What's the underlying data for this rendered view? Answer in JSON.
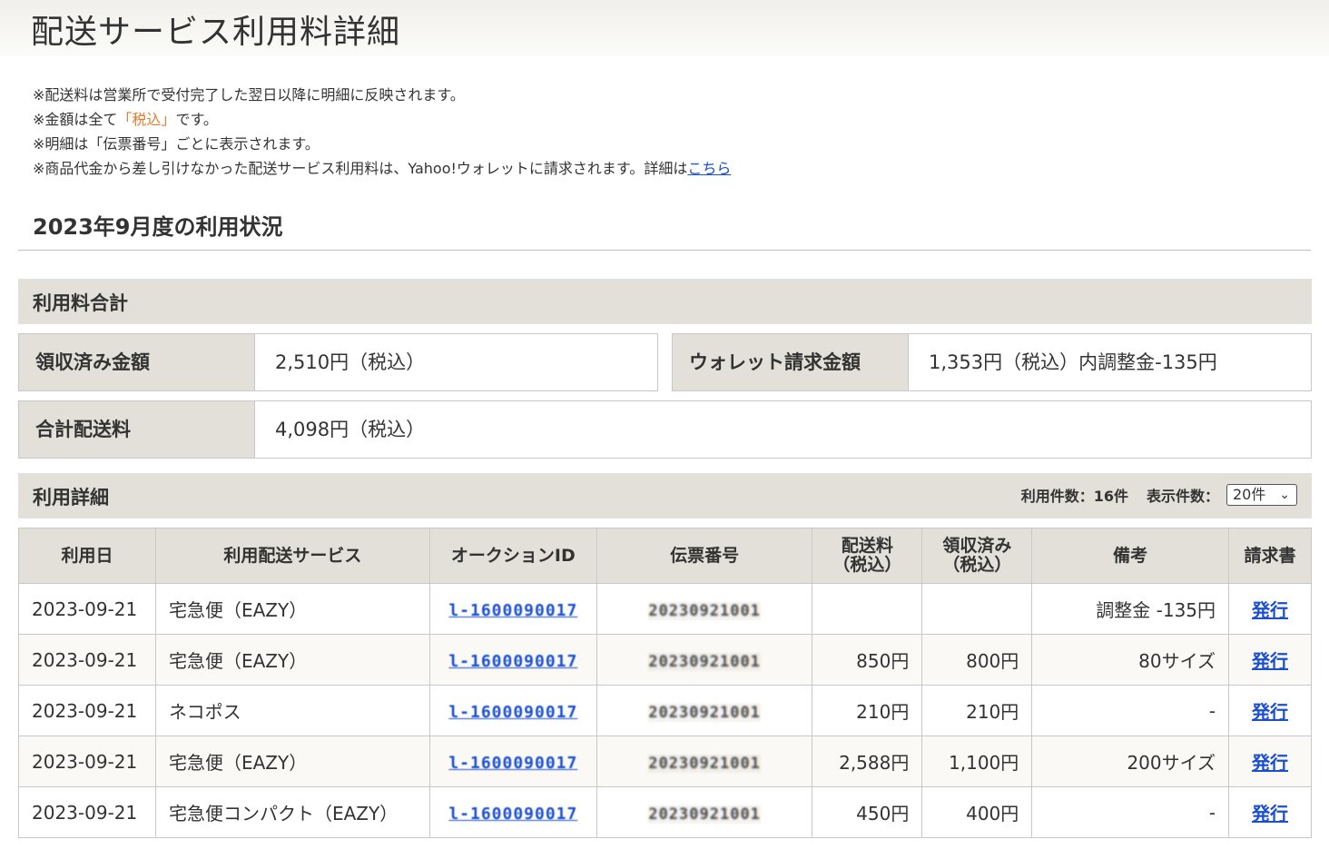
{
  "page_title": "配送サービス利用料詳細",
  "notes": [
    {
      "before": "※配送料は営業所で受付完了した翌日以降に明細に反映されます。",
      "hl": "",
      "after": "",
      "link": ""
    },
    {
      "before": "※金額は全て",
      "hl": "「税込」",
      "after": "です。",
      "link": ""
    },
    {
      "before": "※明細は「伝票番号」ごとに表示されます。",
      "hl": "",
      "after": "",
      "link": ""
    },
    {
      "before": "※商品代金から差し引けなかった配送サービス利用料は、Yahoo!ウォレットに請求されます。詳細は",
      "hl": "",
      "after": "",
      "link": "こちら"
    }
  ],
  "usage_title": "2023年9月度の利用状況",
  "summary": {
    "bar_label": "利用料合計",
    "received_label": "領収済み金額",
    "received_value": "2,510円（税込）",
    "wallet_label": "ウォレット請求金額",
    "wallet_value": "1,353円（税込）内調整金-135円",
    "total_label": "合計配送料",
    "total_value": "4,098円（税込）"
  },
  "detail": {
    "bar_label": "利用詳細",
    "count_text": "利用件数：16件",
    "display_label": "表示件数：",
    "display_selected": "20件",
    "headers": {
      "date": "利用日",
      "service": "利用配送サービス",
      "auction_id": "オークションID",
      "slip": "伝票番号",
      "fee_line1": "配送料",
      "fee_line2": "（税込）",
      "received_line1": "領収済み",
      "received_line2": "（税込）",
      "remarks": "備考",
      "invoice": "請求書"
    },
    "rows": [
      {
        "date": "2023-09-21",
        "service": "宅急便（EAZY）",
        "auction_id": "l-1600090017",
        "slip": "20230921001",
        "fee": "",
        "received": "",
        "remarks": "調整金 -135円",
        "invoice": "発行"
      },
      {
        "date": "2023-09-21",
        "service": "宅急便（EAZY）",
        "auction_id": "l-1600090017",
        "slip": "20230921001",
        "fee": "850円",
        "received": "800円",
        "remarks": "80サイズ",
        "invoice": "発行"
      },
      {
        "date": "2023-09-21",
        "service": "ネコポス",
        "auction_id": "l-1600090017",
        "slip": "20230921001",
        "fee": "210円",
        "received": "210円",
        "remarks": "-",
        "invoice": "発行"
      },
      {
        "date": "2023-09-21",
        "service": "宅急便（EAZY）",
        "auction_id": "l-1600090017",
        "slip": "20230921001",
        "fee": "2,588円",
        "received": "1,100円",
        "remarks": "200サイズ",
        "invoice": "発行"
      },
      {
        "date": "2023-09-21",
        "service": "宅急便コンパクト（EAZY）",
        "auction_id": "l-1600090017",
        "slip": "20230921001",
        "fee": "450円",
        "received": "400円",
        "remarks": "-",
        "invoice": "発行"
      }
    ]
  }
}
